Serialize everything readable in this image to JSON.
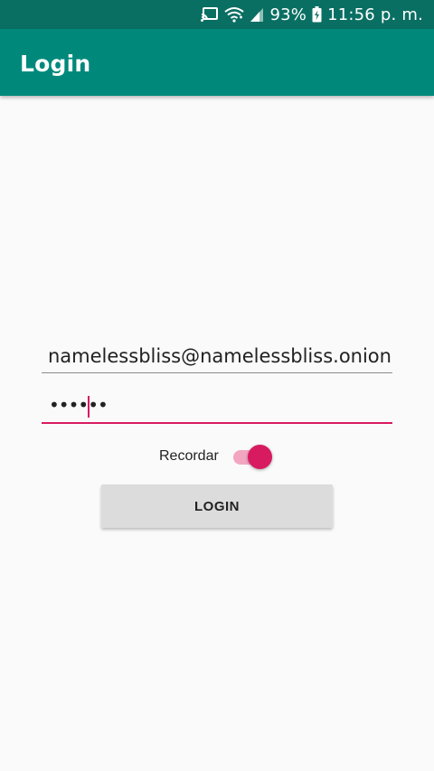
{
  "status_bar": {
    "icons": [
      "cast-icon",
      "wifi-icon",
      "signal-icon",
      "battery-icon"
    ],
    "battery": "93%",
    "time": "11:56 p. m."
  },
  "app_bar": {
    "title": "Login",
    "color": "#00897b"
  },
  "form": {
    "email_value": "namelessbliss@namelessbliss.onion",
    "password_value": "••••••",
    "remember_label": "Recordar",
    "remember_checked": true,
    "login_label": "LOGIN"
  },
  "colors": {
    "accent": "#d81b60",
    "status_bar": "#0a6f63",
    "button": "#dcdcdc"
  }
}
